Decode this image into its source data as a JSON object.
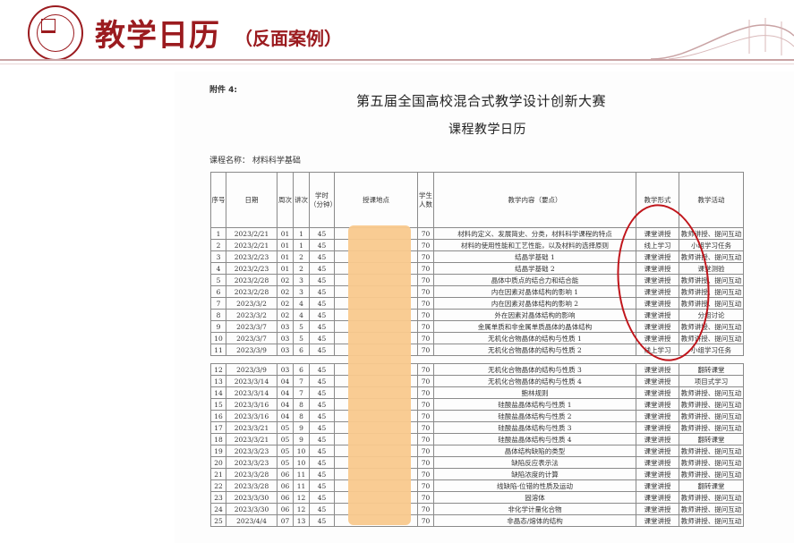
{
  "slide": {
    "title": "教学日历",
    "subtitle": "（反面案例）"
  },
  "document": {
    "attachment": "附件 4:",
    "title": "第五届全国高校混合式教学设计创新大赛",
    "subtitle": "课程教学日历",
    "course": "课程名称：  材料科学基础"
  },
  "colors": {
    "brand": "#9b1b1f",
    "highlight": "#f9c98d",
    "oval": "#c0151b"
  },
  "table": {
    "headers": {
      "seq": "序号",
      "date": "日期",
      "week": "周次",
      "lecture": "讲次",
      "hours": "学时（分钟）",
      "location": "授课地点",
      "students": "学生人数",
      "content": "教学内容（要点）",
      "form": "教学形式",
      "activity": "教学活动"
    },
    "rows": [
      {
        "n": "1",
        "date": "2023/2/21",
        "week": "01",
        "lec": "1",
        "hrs": "45",
        "stu": "70",
        "content": "材料的定义、发展简史、分类，材料科学课程的特点",
        "form": "课堂讲授",
        "act": "教师讲授、提问互动"
      },
      {
        "n": "2",
        "date": "2023/2/21",
        "week": "01",
        "lec": "1",
        "hrs": "45",
        "stu": "70",
        "content": "材料的使用性能和工艺性能，以及材料的选择原则",
        "form": "线上学习",
        "act": "小组学习任务"
      },
      {
        "n": "3",
        "date": "2023/2/23",
        "week": "01",
        "lec": "2",
        "hrs": "45",
        "stu": "70",
        "content": "结晶学基础 1",
        "form": "课堂讲授",
        "act": "教师讲授、提问互动"
      },
      {
        "n": "4",
        "date": "2023/2/23",
        "week": "01",
        "lec": "2",
        "hrs": "45",
        "stu": "70",
        "content": "结晶学基础 2",
        "form": "课堂讲授",
        "act": "课堂测验"
      },
      {
        "n": "5",
        "date": "2023/2/28",
        "week": "02",
        "lec": "3",
        "hrs": "45",
        "stu": "70",
        "content": "晶体中质点的结合力和结合能",
        "form": "课堂讲授",
        "act": "教师讲授、提问互动"
      },
      {
        "n": "6",
        "date": "2023/2/28",
        "week": "02",
        "lec": "3",
        "hrs": "45",
        "stu": "70",
        "content": "内在因素对晶体结构的影响 1",
        "form": "课堂讲授",
        "act": "教师讲授、提问互动"
      },
      {
        "n": "7",
        "date": "2023/3/2",
        "week": "02",
        "lec": "4",
        "hrs": "45",
        "stu": "70",
        "content": "内在因素对晶体结构的影响 2",
        "form": "课堂讲授",
        "act": "教师讲授、提问互动"
      },
      {
        "n": "8",
        "date": "2023/3/2",
        "week": "02",
        "lec": "4",
        "hrs": "45",
        "stu": "70",
        "content": "外在因素对晶体结构的影响",
        "form": "课堂讲授",
        "act": "分组讨论"
      },
      {
        "n": "9",
        "date": "2023/3/7",
        "week": "03",
        "lec": "5",
        "hrs": "45",
        "stu": "70",
        "content": "金属单质和非金属单质晶体的晶体结构",
        "form": "课堂讲授",
        "act": "教师讲授、提问互动"
      },
      {
        "n": "10",
        "date": "2023/3/7",
        "week": "03",
        "lec": "5",
        "hrs": "45",
        "stu": "70",
        "content": "无机化合物晶体的结构与性质 1",
        "form": "课堂讲授",
        "act": "教师讲授、提问互动"
      },
      {
        "n": "11",
        "date": "2023/3/9",
        "week": "03",
        "lec": "6",
        "hrs": "45",
        "stu": "70",
        "content": "无机化合物晶体的结构与性质 2",
        "form": "线上学习",
        "act": "小组学习任务"
      },
      {
        "n": "12",
        "date": "2023/3/9",
        "week": "03",
        "lec": "6",
        "hrs": "45",
        "stu": "70",
        "content": "无机化合物晶体的结构与性质 3",
        "form": "课堂讲授",
        "act": "翻转课堂"
      },
      {
        "n": "13",
        "date": "2023/3/14",
        "week": "04",
        "lec": "7",
        "hrs": "45",
        "stu": "70",
        "content": "无机化合物晶体的结构与性质 4",
        "form": "课堂讲授",
        "act": "项目式学习"
      },
      {
        "n": "14",
        "date": "2023/3/14",
        "week": "04",
        "lec": "7",
        "hrs": "45",
        "stu": "70",
        "content": "鲍林规则",
        "form": "课堂讲授",
        "act": "教师讲授、提问互动"
      },
      {
        "n": "15",
        "date": "2023/3/16",
        "week": "04",
        "lec": "8",
        "hrs": "45",
        "stu": "70",
        "content": "硅酸盐晶体结构与性质 1",
        "form": "课堂讲授",
        "act": "教师讲授、提问互动"
      },
      {
        "n": "16",
        "date": "2023/3/16",
        "week": "04",
        "lec": "8",
        "hrs": "45",
        "stu": "70",
        "content": "硅酸盐晶体结构与性质 2",
        "form": "课堂讲授",
        "act": "教师讲授、提问互动"
      },
      {
        "n": "17",
        "date": "2023/3/21",
        "week": "05",
        "lec": "9",
        "hrs": "45",
        "stu": "70",
        "content": "硅酸盐晶体结构与性质 3",
        "form": "课堂讲授",
        "act": "教师讲授、提问互动"
      },
      {
        "n": "18",
        "date": "2023/3/21",
        "week": "05",
        "lec": "9",
        "hrs": "45",
        "stu": "70",
        "content": "硅酸盐晶体结构与性质 4",
        "form": "课堂讲授",
        "act": "翻转课堂"
      },
      {
        "n": "19",
        "date": "2023/3/23",
        "week": "05",
        "lec": "10",
        "hrs": "45",
        "stu": "70",
        "content": "晶体结构缺陷的类型",
        "form": "课堂讲授",
        "act": "教师讲授、提问互动"
      },
      {
        "n": "20",
        "date": "2023/3/23",
        "week": "05",
        "lec": "10",
        "hrs": "45",
        "stu": "70",
        "content": "缺陷反应表示法",
        "form": "课堂讲授",
        "act": "教师讲授、提问互动"
      },
      {
        "n": "21",
        "date": "2023/3/28",
        "week": "06",
        "lec": "11",
        "hrs": "45",
        "stu": "70",
        "content": "缺陷浓度的计算",
        "form": "课堂讲授",
        "act": "教师讲授、提问互动"
      },
      {
        "n": "22",
        "date": "2023/3/28",
        "week": "06",
        "lec": "11",
        "hrs": "45",
        "stu": "70",
        "content": "线缺陷-位错的性质及运动",
        "form": "课堂讲授",
        "act": "翻转课堂"
      },
      {
        "n": "23",
        "date": "2023/3/30",
        "week": "06",
        "lec": "12",
        "hrs": "45",
        "stu": "70",
        "content": "固溶体",
        "form": "课堂讲授",
        "act": "教师讲授、提问互动"
      },
      {
        "n": "24",
        "date": "2023/3/30",
        "week": "06",
        "lec": "12",
        "hrs": "45",
        "stu": "70",
        "content": "非化学计量化合物",
        "form": "课堂讲授",
        "act": "教师讲授、提问互动"
      },
      {
        "n": "25",
        "date": "2023/4/4",
        "week": "07",
        "lec": "13",
        "hrs": "45",
        "stu": "70",
        "content": "非晶态/熔体的结构",
        "form": "课堂讲授",
        "act": "教师讲授、提问互动"
      }
    ]
  }
}
